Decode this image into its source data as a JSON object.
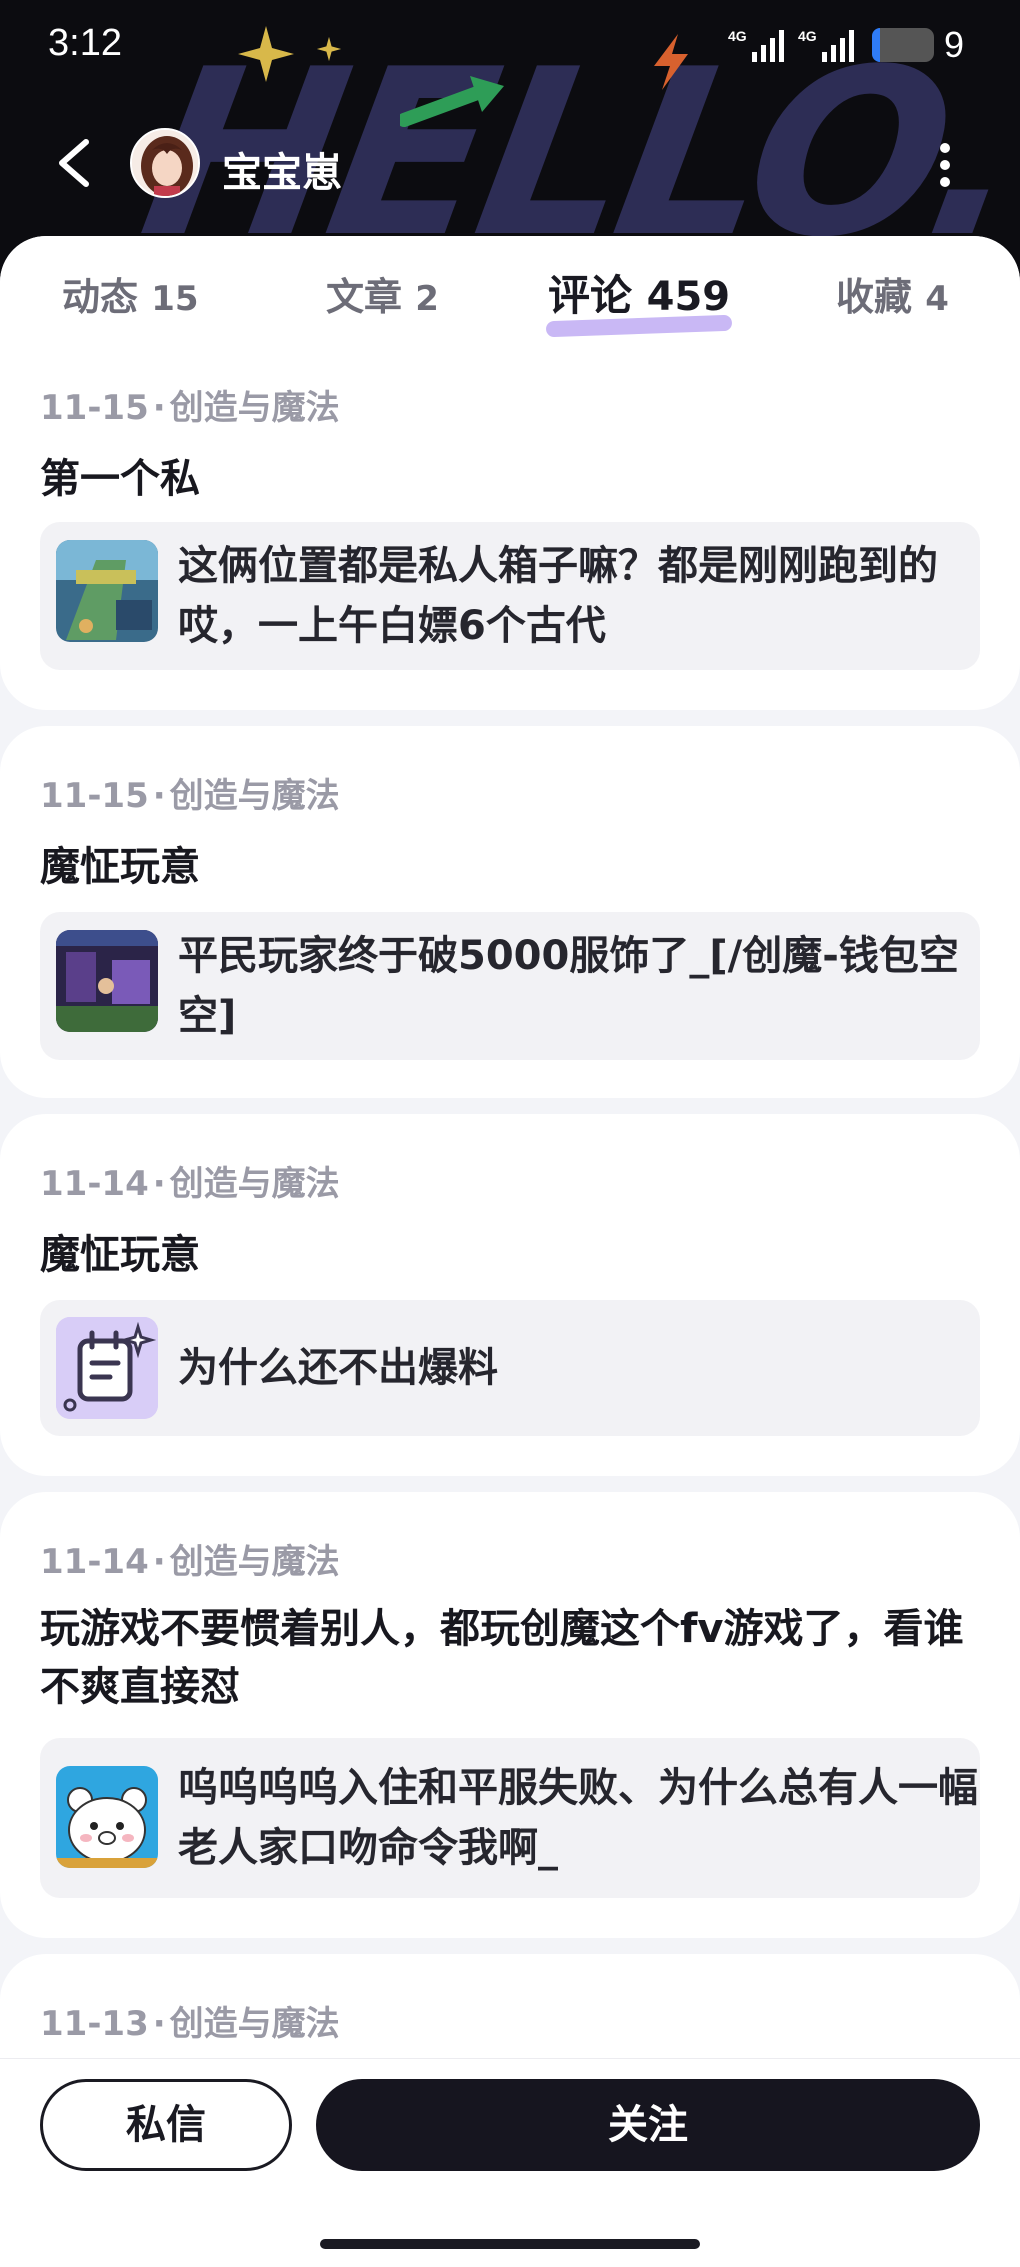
{
  "status_bar": {
    "time": "3:12",
    "signal1": "4G",
    "signal2": "4G",
    "battery_level": "9"
  },
  "header": {
    "user_name": "宝宝崽",
    "background_word": "HELLO."
  },
  "tabs": [
    {
      "label": "动态",
      "count": "15"
    },
    {
      "label": "文章",
      "count": "2"
    },
    {
      "label": "评论",
      "count": "459"
    },
    {
      "label": "收藏",
      "count": "4"
    }
  ],
  "active_tab": "评论",
  "accent_color": "#c9b8f5",
  "comments": [
    {
      "date": "11-15",
      "dot": "·",
      "game": "创造与魔法",
      "text": "第一个私",
      "quote": "这俩位置都是私人箱子嘛？都是刚刚跑到的哎，一上午白嫖6个古代",
      "thumb_icon": "game-screenshot-icon"
    },
    {
      "date": "11-15",
      "dot": "·",
      "game": "创造与魔法",
      "text": "魔怔玩意",
      "quote": "平民玩家终于破5000服饰了_[/创魔-钱包空空]",
      "thumb_icon": "game-screenshot-icon"
    },
    {
      "date": "11-14",
      "dot": "·",
      "game": "创造与魔法",
      "text": "魔怔玩意",
      "quote": "为什么还不出爆料",
      "thumb_icon": "note-icon"
    },
    {
      "date": "11-14",
      "dot": "·",
      "game": "创造与魔法",
      "text": "玩游戏不要惯着别人，都玩创魔这个fv游戏了，看谁不爽直接怼",
      "quote": "呜呜呜呜入住和平服失败、为什么总有人一幅老人家口吻命令我啊_",
      "thumb_icon": "cartoon-bear-icon"
    },
    {
      "date": "11-13",
      "dot": "·",
      "game": "创造与魔法"
    }
  ],
  "actions": {
    "message_label": "私信",
    "follow_label": "关注"
  }
}
